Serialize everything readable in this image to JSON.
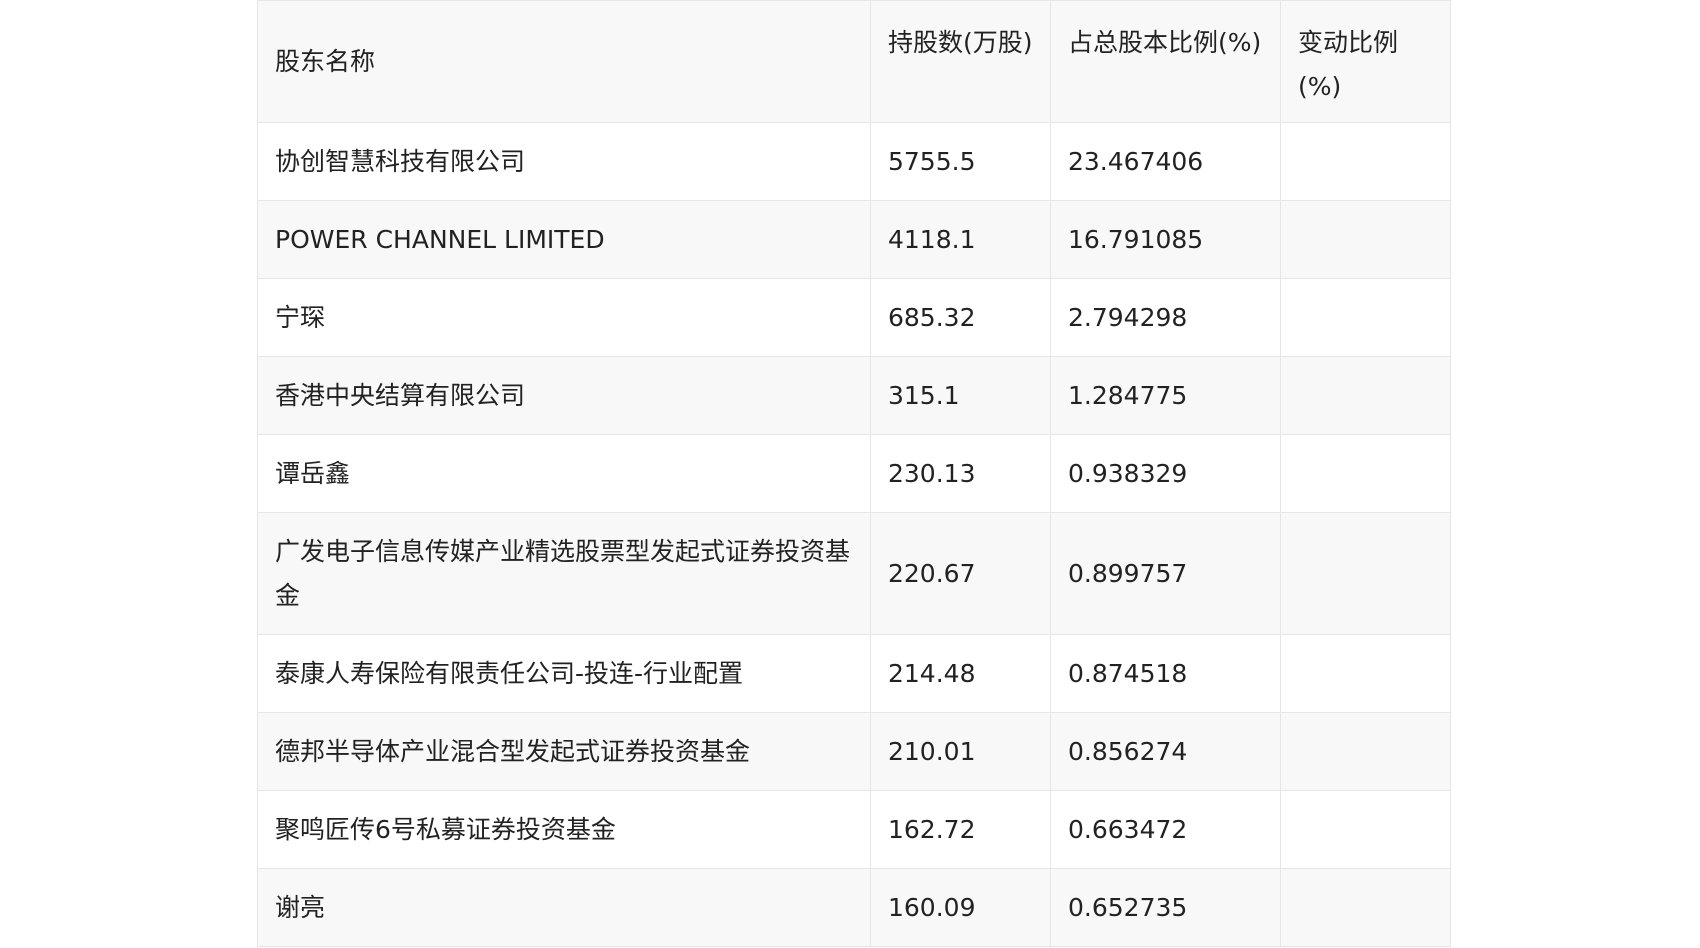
{
  "table": {
    "headers": [
      "股东名称",
      "持股数(万股)",
      "占总股本比例(%)",
      "变动比例(%)"
    ],
    "rows": [
      [
        "协创智慧科技有限公司",
        "5755.5",
        "23.467406",
        ""
      ],
      [
        "POWER CHANNEL LIMITED",
        "4118.1",
        "16.791085",
        ""
      ],
      [
        "宁琛",
        "685.32",
        "2.794298",
        ""
      ],
      [
        "香港中央结算有限公司",
        "315.1",
        "1.284775",
        ""
      ],
      [
        "谭岳鑫",
        "230.13",
        "0.938329",
        ""
      ],
      [
        "广发电子信息传媒产业精选股票型发起式证券投资基金",
        "220.67",
        "0.899757",
        ""
      ],
      [
        "泰康人寿保险有限责任公司-投连-行业配置",
        "214.48",
        "0.874518",
        ""
      ],
      [
        "德邦半导体产业混合型发起式证券投资基金",
        "210.01",
        "0.856274",
        ""
      ],
      [
        "聚鸣匠传6号私募证券投资基金",
        "162.72",
        "0.663472",
        ""
      ],
      [
        "谢亮",
        "160.09",
        "0.652735",
        ""
      ]
    ]
  }
}
